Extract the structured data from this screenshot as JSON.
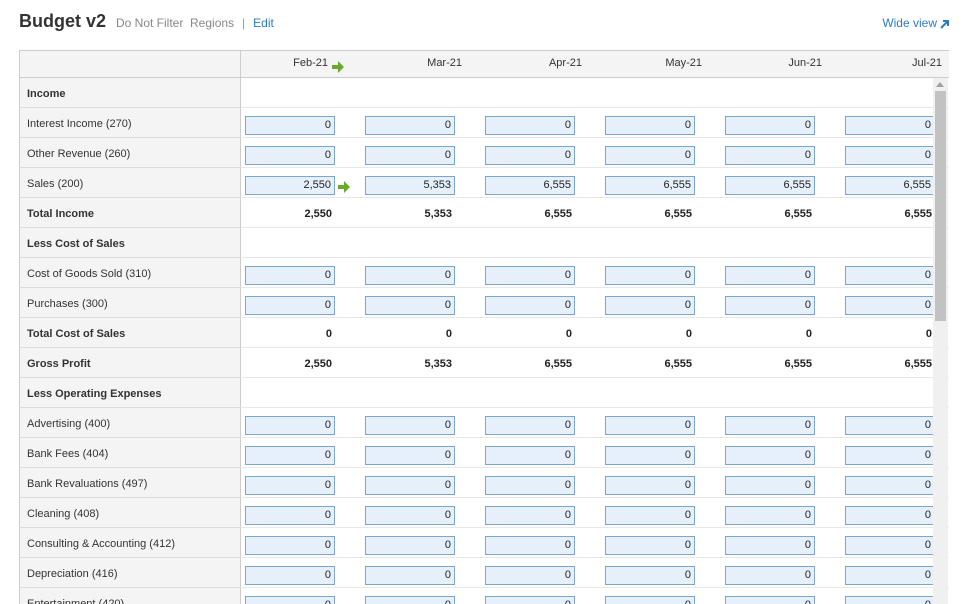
{
  "header": {
    "title": "Budget v2",
    "filter_text": "Do Not Filter  Regions",
    "separator": "|",
    "edit_label": "Edit",
    "wide_view_label": "Wide view"
  },
  "months": [
    "Feb-21",
    "Mar-21",
    "Apr-21",
    "May-21",
    "Jun-21",
    "Jul-21"
  ],
  "rows": [
    {
      "label": "Income",
      "type": "section",
      "values": []
    },
    {
      "label": "Interest Income (270)",
      "type": "input",
      "values": [
        "0",
        "0",
        "0",
        "0",
        "0",
        "0"
      ]
    },
    {
      "label": "Other Revenue (260)",
      "type": "input",
      "values": [
        "0",
        "0",
        "0",
        "0",
        "0",
        "0"
      ]
    },
    {
      "label": "Sales (200)",
      "type": "input",
      "values": [
        "2,550",
        "5,353",
        "6,555",
        "6,555",
        "6,555",
        "6,555"
      ],
      "arrow": true
    },
    {
      "label": "Total Income",
      "type": "total",
      "values": [
        "2,550",
        "5,353",
        "6,555",
        "6,555",
        "6,555",
        "6,555"
      ]
    },
    {
      "label": "Less Cost of Sales",
      "type": "section",
      "values": []
    },
    {
      "label": "Cost of Goods Sold (310)",
      "type": "input",
      "values": [
        "0",
        "0",
        "0",
        "0",
        "0",
        "0"
      ]
    },
    {
      "label": "Purchases (300)",
      "type": "input",
      "values": [
        "0",
        "0",
        "0",
        "0",
        "0",
        "0"
      ]
    },
    {
      "label": "Total Cost of Sales",
      "type": "total",
      "values": [
        "0",
        "0",
        "0",
        "0",
        "0",
        "0"
      ]
    },
    {
      "label": "Gross Profit",
      "type": "total",
      "values": [
        "2,550",
        "5,353",
        "6,555",
        "6,555",
        "6,555",
        "6,555"
      ]
    },
    {
      "label": "Less Operating Expenses",
      "type": "section",
      "values": []
    },
    {
      "label": "Advertising (400)",
      "type": "input",
      "values": [
        "0",
        "0",
        "0",
        "0",
        "0",
        "0"
      ]
    },
    {
      "label": "Bank Fees (404)",
      "type": "input",
      "values": [
        "0",
        "0",
        "0",
        "0",
        "0",
        "0"
      ]
    },
    {
      "label": "Bank Revaluations (497)",
      "type": "input",
      "values": [
        "0",
        "0",
        "0",
        "0",
        "0",
        "0"
      ]
    },
    {
      "label": "Cleaning (408)",
      "type": "input",
      "values": [
        "0",
        "0",
        "0",
        "0",
        "0",
        "0"
      ]
    },
    {
      "label": "Consulting & Accounting (412)",
      "type": "input",
      "values": [
        "0",
        "0",
        "0",
        "0",
        "0",
        "0"
      ]
    },
    {
      "label": "Depreciation (416)",
      "type": "input",
      "values": [
        "0",
        "0",
        "0",
        "0",
        "0",
        "0"
      ]
    },
    {
      "label": "Entertainment (420)",
      "type": "input",
      "values": [
        "0",
        "0",
        "0",
        "0",
        "0",
        "0"
      ]
    }
  ],
  "colors": {
    "input_bg": "#e6f0fb",
    "input_border": "#7ea6cc",
    "link": "#2e7bbf",
    "arrow": "#6aa82e"
  }
}
